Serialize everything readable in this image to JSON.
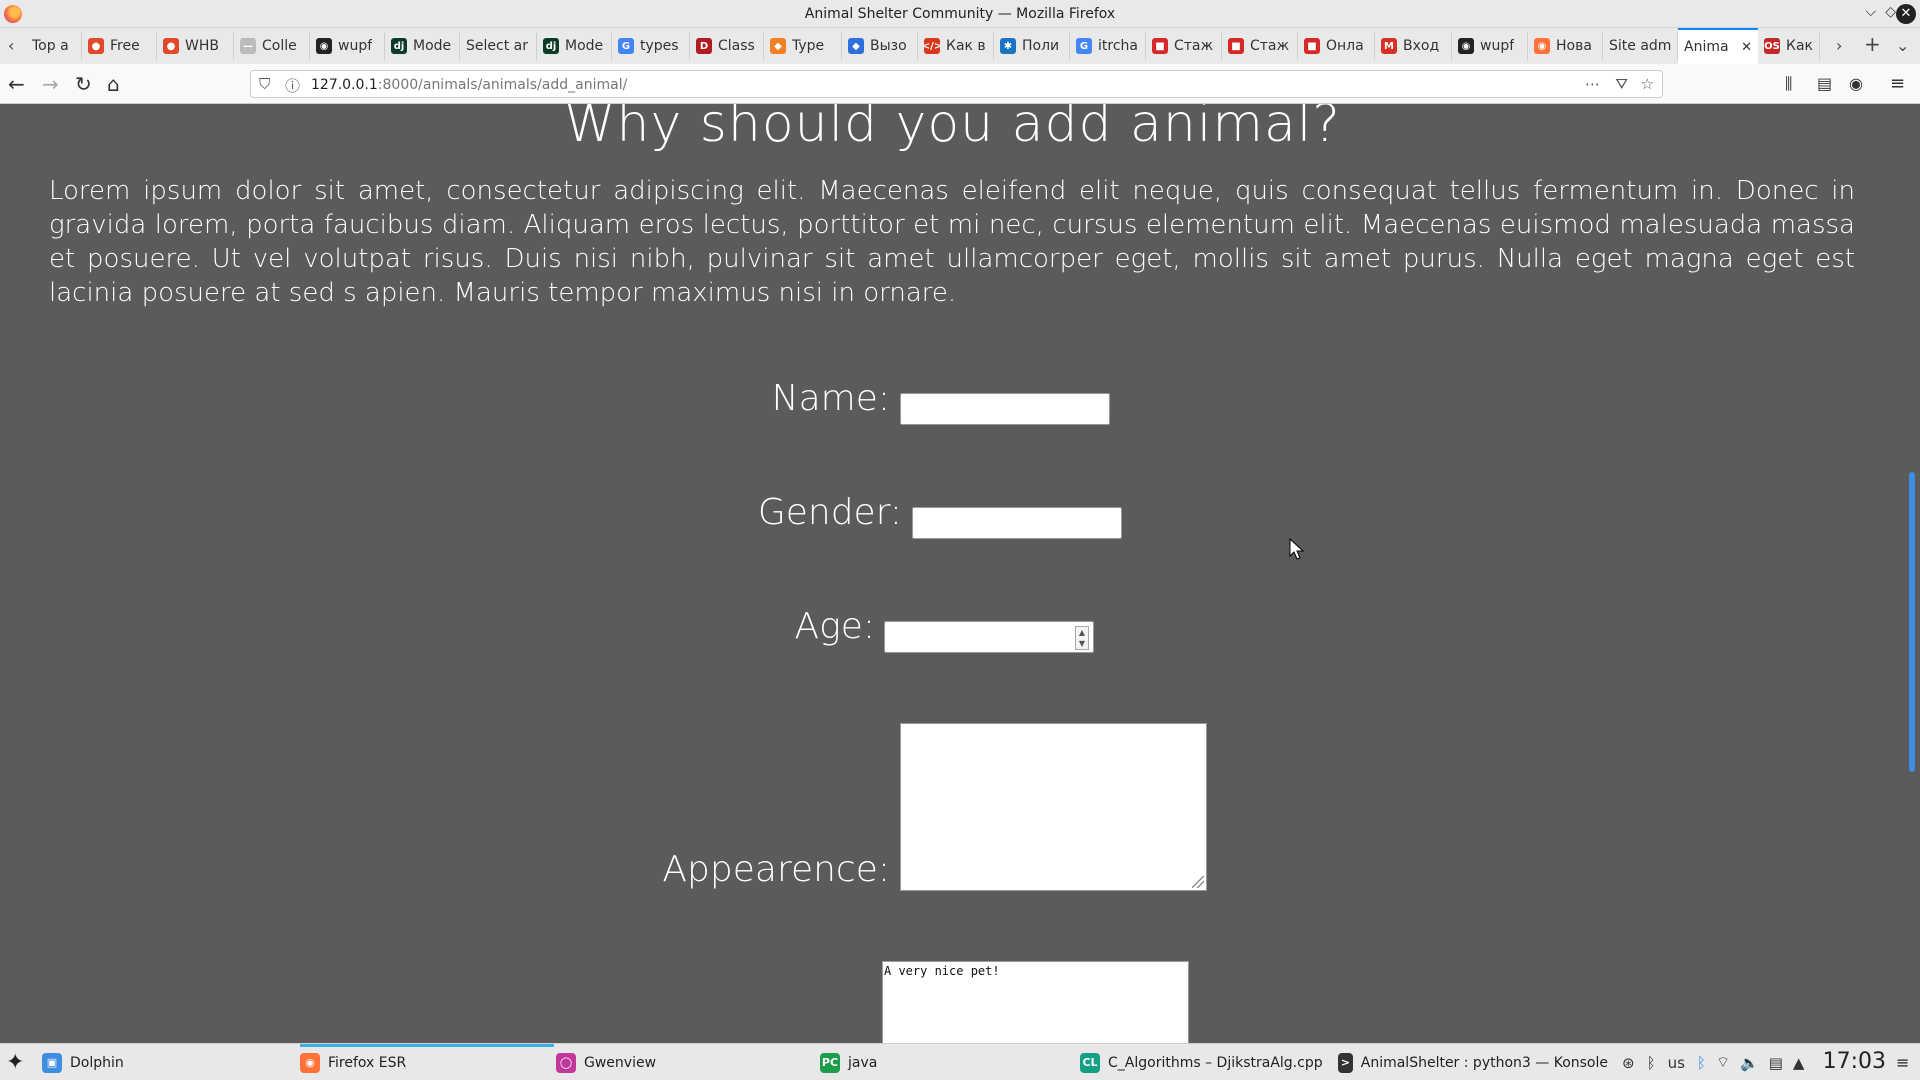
{
  "window": {
    "title": "Animal Shelter Community — Mozilla Firefox"
  },
  "tabs": [
    {
      "label": "Top a",
      "fav": "",
      "color": "#e9e9e9"
    },
    {
      "label": "Free",
      "fav": "●",
      "color": "#e04a2b"
    },
    {
      "label": "WHB",
      "fav": "●",
      "color": "#e04a2b"
    },
    {
      "label": "Colle",
      "fav": "—",
      "color": "#bbbbbb"
    },
    {
      "label": "wupf",
      "fav": "◉",
      "color": "#222222"
    },
    {
      "label": "Mode",
      "fav": "dj",
      "color": "#0c3c26"
    },
    {
      "label": "Select ar",
      "fav": "",
      "color": "#e9e9e9"
    },
    {
      "label": "Mode",
      "fav": "dj",
      "color": "#0c3c26"
    },
    {
      "label": "types",
      "fav": "G",
      "color": "#4285f4"
    },
    {
      "label": "Class",
      "fav": "D",
      "color": "#b01c20"
    },
    {
      "label": "Type",
      "fav": "◆",
      "color": "#f48024"
    },
    {
      "label": "Вызо",
      "fav": "◆",
      "color": "#2f6fdb"
    },
    {
      "label": "Как в",
      "fav": "</>",
      "color": "#d9381e"
    },
    {
      "label": "Поли",
      "fav": "✱",
      "color": "#1b74c3"
    },
    {
      "label": "itrcha",
      "fav": "G",
      "color": "#4285f4"
    },
    {
      "label": "Стаж",
      "fav": "■",
      "color": "#d72828"
    },
    {
      "label": "Стаж",
      "fav": "■",
      "color": "#d72828"
    },
    {
      "label": "Онла",
      "fav": "■",
      "color": "#d72828"
    },
    {
      "label": "Вход",
      "fav": "M",
      "color": "#d93025"
    },
    {
      "label": "wupf",
      "fav": "◉",
      "color": "#222222"
    },
    {
      "label": "Нова",
      "fav": "◉",
      "color": "#ff7139"
    },
    {
      "label": "Site adm",
      "fav": "",
      "color": "#e9e9e9"
    },
    {
      "label": "Anima",
      "fav": "",
      "color": "#e9e9e9",
      "active": true
    },
    {
      "label": "Как д",
      "fav": "OS",
      "color": "#c62828"
    }
  ],
  "navbar": {
    "url_host": "127.0.0.1",
    "url_rest": ":8000/animals/animals/add_animal/"
  },
  "page": {
    "heading": "Why should you add animal?",
    "paragraph": "Lorem ipsum dolor sit amet, consectetur adipiscing elit. Maecenas eleifend elit neque, quis consequat tellus fermentum in. Donec in gravida lorem, porta faucibus diam. Aliquam eros lectus, porttitor et mi nec, cursus elementum elit. Maecenas euismod malesuada massa et posuere. Ut vel volutpat risus. Duis nisi nibh, pulvinar sit amet ullamcorper eget, mollis sit amet purus. Nulla eget magna eget est lacinia posuere at sed s apien. Mauris tempor maximus nisi in ornare.",
    "form": {
      "name_label": "Name:",
      "name_value": "",
      "gender_label": "Gender:",
      "gender_value": "",
      "age_label": "Age:",
      "age_value": "",
      "appearance_label": "Appearence:",
      "appearance_value": "",
      "description_value": "A very nice pet!"
    }
  },
  "taskbar": {
    "items": [
      {
        "label": "Dolphin",
        "icon": "▣",
        "color": "#3d8de0"
      },
      {
        "label": "Firefox ESR",
        "icon": "◉",
        "color": "#ff7139",
        "active": true
      },
      {
        "label": "Gwenview",
        "icon": "◯",
        "color": "#c0399a"
      },
      {
        "label": "java",
        "icon": "PC",
        "color": "#1c9d4b"
      },
      {
        "label": "C_Algorithms – DjikstraAlg.cpp",
        "icon": "CL",
        "color": "#14a085"
      },
      {
        "label": "AnimalShelter : python3 — Konsole",
        "icon": ">",
        "color": "#333333"
      }
    ],
    "layout": "us",
    "clock": "17:03"
  }
}
